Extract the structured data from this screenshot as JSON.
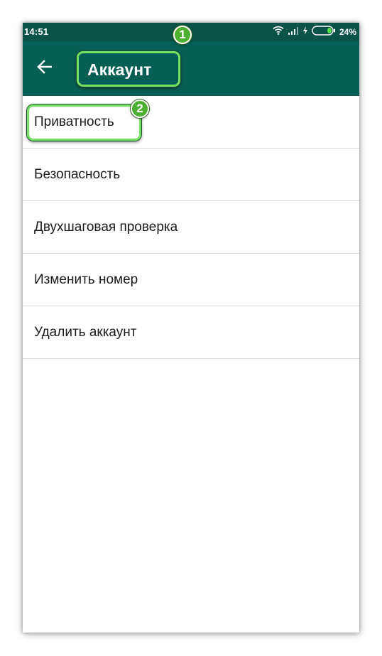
{
  "status_bar": {
    "time": "14:51",
    "battery_percent": "24%",
    "battery_level": 0.24,
    "icons": [
      "wifi-icon",
      "signal-icon",
      "charging-icon",
      "battery-icon"
    ]
  },
  "app_bar": {
    "title": "Аккаунт",
    "back_icon": "arrow-left-icon"
  },
  "annotations": {
    "badge_1": "1",
    "badge_2": "2"
  },
  "menu": {
    "items": [
      {
        "label": "Приватность"
      },
      {
        "label": "Безопасность"
      },
      {
        "label": "Двухшаговая проверка"
      },
      {
        "label": "Изменить номер"
      },
      {
        "label": "Удалить аккаунт"
      }
    ]
  },
  "colors": {
    "status_bar": "#0b5247",
    "app_bar": "#075e54",
    "highlight": "#76e063",
    "badge": "#4caf2f"
  }
}
